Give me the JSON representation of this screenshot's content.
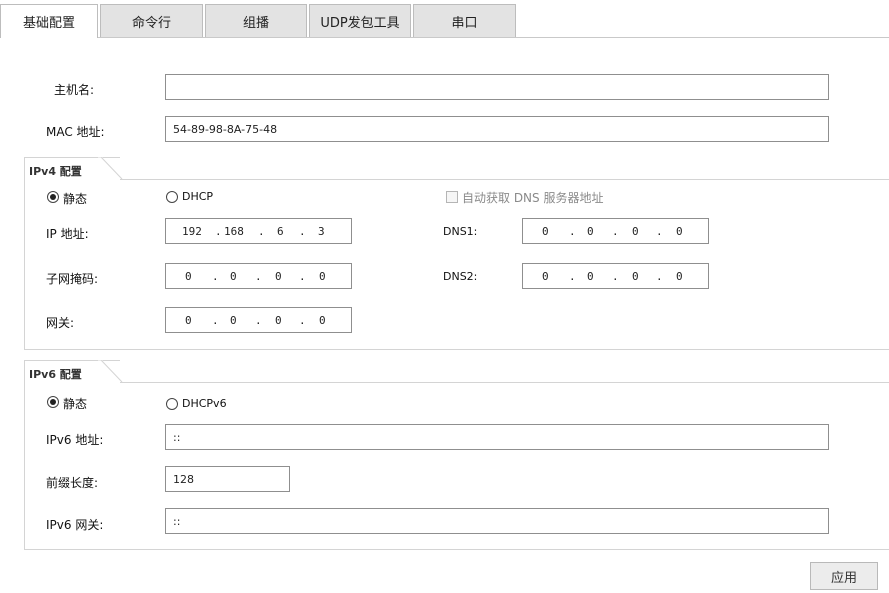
{
  "tabs": [
    {
      "label": "基础配置",
      "active": true
    },
    {
      "label": "命令行",
      "active": false
    },
    {
      "label": "组播",
      "active": false
    },
    {
      "label": "UDP发包工具",
      "active": false
    },
    {
      "label": "串口",
      "active": false
    }
  ],
  "basic": {
    "hostname_label": "主机名:",
    "hostname_value": "",
    "mac_label": "MAC 地址:",
    "mac_value": "54-89-98-8A-75-48"
  },
  "ipv4": {
    "legend": "IPv4 配置",
    "static_label": "静态",
    "static_selected": true,
    "dhcp_label": "DHCP",
    "auto_dns_label": "自动获取 DNS 服务器地址",
    "ip_label": "IP 地址:",
    "ip": [
      "192",
      "168",
      "6",
      "3"
    ],
    "mask_label": "子网掩码:",
    "mask": [
      "0",
      "0",
      "0",
      "0"
    ],
    "gateway_label": "网关:",
    "gateway": [
      "0",
      "0",
      "0",
      "0"
    ],
    "dns1_label": "DNS1:",
    "dns1": [
      "0",
      "0",
      "0",
      "0"
    ],
    "dns2_label": "DNS2:",
    "dns2": [
      "0",
      "0",
      "0",
      "0"
    ]
  },
  "ipv6": {
    "legend": "IPv6 配置",
    "static_label": "静态",
    "static_selected": true,
    "dhcp_label": "DHCPv6",
    "addr_label": "IPv6 地址:",
    "addr_value": "::",
    "prefix_label": "前缀长度:",
    "prefix_value": "128",
    "gateway_label": "IPv6 网关:",
    "gateway_value": "::"
  },
  "apply_label": "应用"
}
